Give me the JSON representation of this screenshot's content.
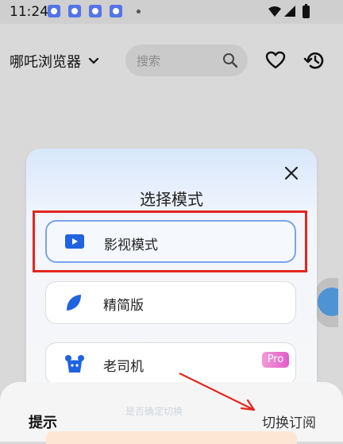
{
  "status_bar": {
    "time": "11:24"
  },
  "header": {
    "app_name": "哪吒浏览器",
    "search_placeholder": "搜索"
  },
  "dialog": {
    "title": "选择模式",
    "options": [
      {
        "label": "影视模式",
        "icon": "play-icon",
        "selected": true
      },
      {
        "label": "精简版",
        "icon": "leaf-icon",
        "selected": false
      },
      {
        "label": "老司机",
        "icon": "mascot-icon",
        "selected": false,
        "badge": "Pro"
      }
    ]
  },
  "bottom_sheet": {
    "title": "提示",
    "faded_text": "是否确定切换",
    "link": "切换订阅"
  },
  "colors": {
    "accent_blue": "#1f63e0",
    "highlight_red": "#e3251d",
    "pro_badge": "#e05cc8"
  }
}
